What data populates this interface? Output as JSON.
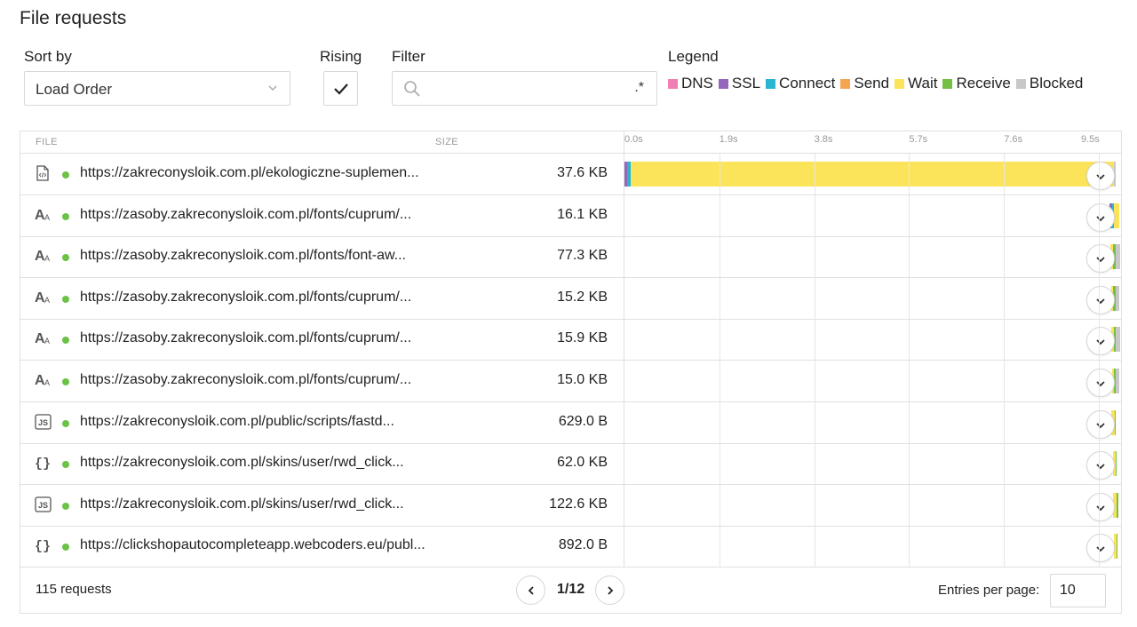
{
  "page": {
    "title": "File requests"
  },
  "controls": {
    "sort_label": "Sort by",
    "sort_value": "Load Order",
    "rising_label": "Rising",
    "rising_checked": true,
    "filter_label": "Filter",
    "filter_value": "",
    "filter_regex_marker": ".*",
    "legend_label": "Legend"
  },
  "legend": [
    {
      "label": "DNS",
      "color": "#f07fb3"
    },
    {
      "label": "SSL",
      "color": "#9467bd"
    },
    {
      "label": "Connect",
      "color": "#29b6d1"
    },
    {
      "label": "Send",
      "color": "#f5a451"
    },
    {
      "label": "Wait",
      "color": "#fbe35a"
    },
    {
      "label": "Receive",
      "color": "#74c043"
    },
    {
      "label": "Blocked",
      "color": "#c8c8c8"
    }
  ],
  "table": {
    "headers": {
      "file": "FILE",
      "size": "SIZE"
    },
    "timeline_ticks": [
      "0.0s",
      "1.9s",
      "3.8s",
      "5.7s",
      "7.6s",
      "9.5s"
    ],
    "timeline_max_s": 9.5,
    "rows": [
      {
        "icon": "html-file-icon",
        "status": "ok",
        "url": "https://zakreconysloik.com.pl/ekologiczne-suplemen...",
        "size": "37.6 KB"
      },
      {
        "icon": "font-file-icon",
        "status": "ok",
        "url": "https://zasoby.zakreconysloik.com.pl/fonts/cuprum/...",
        "size": "16.1 KB"
      },
      {
        "icon": "font-file-icon",
        "status": "ok",
        "url": "https://zasoby.zakreconysloik.com.pl/fonts/font-aw...",
        "size": "77.3 KB"
      },
      {
        "icon": "font-file-icon",
        "status": "ok",
        "url": "https://zasoby.zakreconysloik.com.pl/fonts/cuprum/...",
        "size": "15.2 KB"
      },
      {
        "icon": "font-file-icon",
        "status": "ok",
        "url": "https://zasoby.zakreconysloik.com.pl/fonts/cuprum/...",
        "size": "15.9 KB"
      },
      {
        "icon": "font-file-icon",
        "status": "ok",
        "url": "https://zasoby.zakreconysloik.com.pl/fonts/cuprum/...",
        "size": "15.0 KB"
      },
      {
        "icon": "js-file-icon",
        "status": "ok",
        "url": "https://zakreconysloik.com.pl/public/scripts/fastd...",
        "size": "629.0 B"
      },
      {
        "icon": "json-file-icon",
        "status": "ok",
        "url": "https://zakreconysloik.com.pl/skins/user/rwd_click...",
        "size": "62.0 KB"
      },
      {
        "icon": "js-file-icon",
        "status": "ok",
        "url": "https://zakreconysloik.com.pl/skins/user/rwd_click...",
        "size": "122.6 KB"
      },
      {
        "icon": "json-file-icon",
        "status": "ok",
        "url": "https://clickshopautocompleteapp.webcoders.eu/publ...",
        "size": "892.0 B"
      }
    ]
  },
  "footer": {
    "count": "115 requests",
    "page": "1/12",
    "entries_label": "Entries per page:",
    "entries_value": "10"
  }
}
